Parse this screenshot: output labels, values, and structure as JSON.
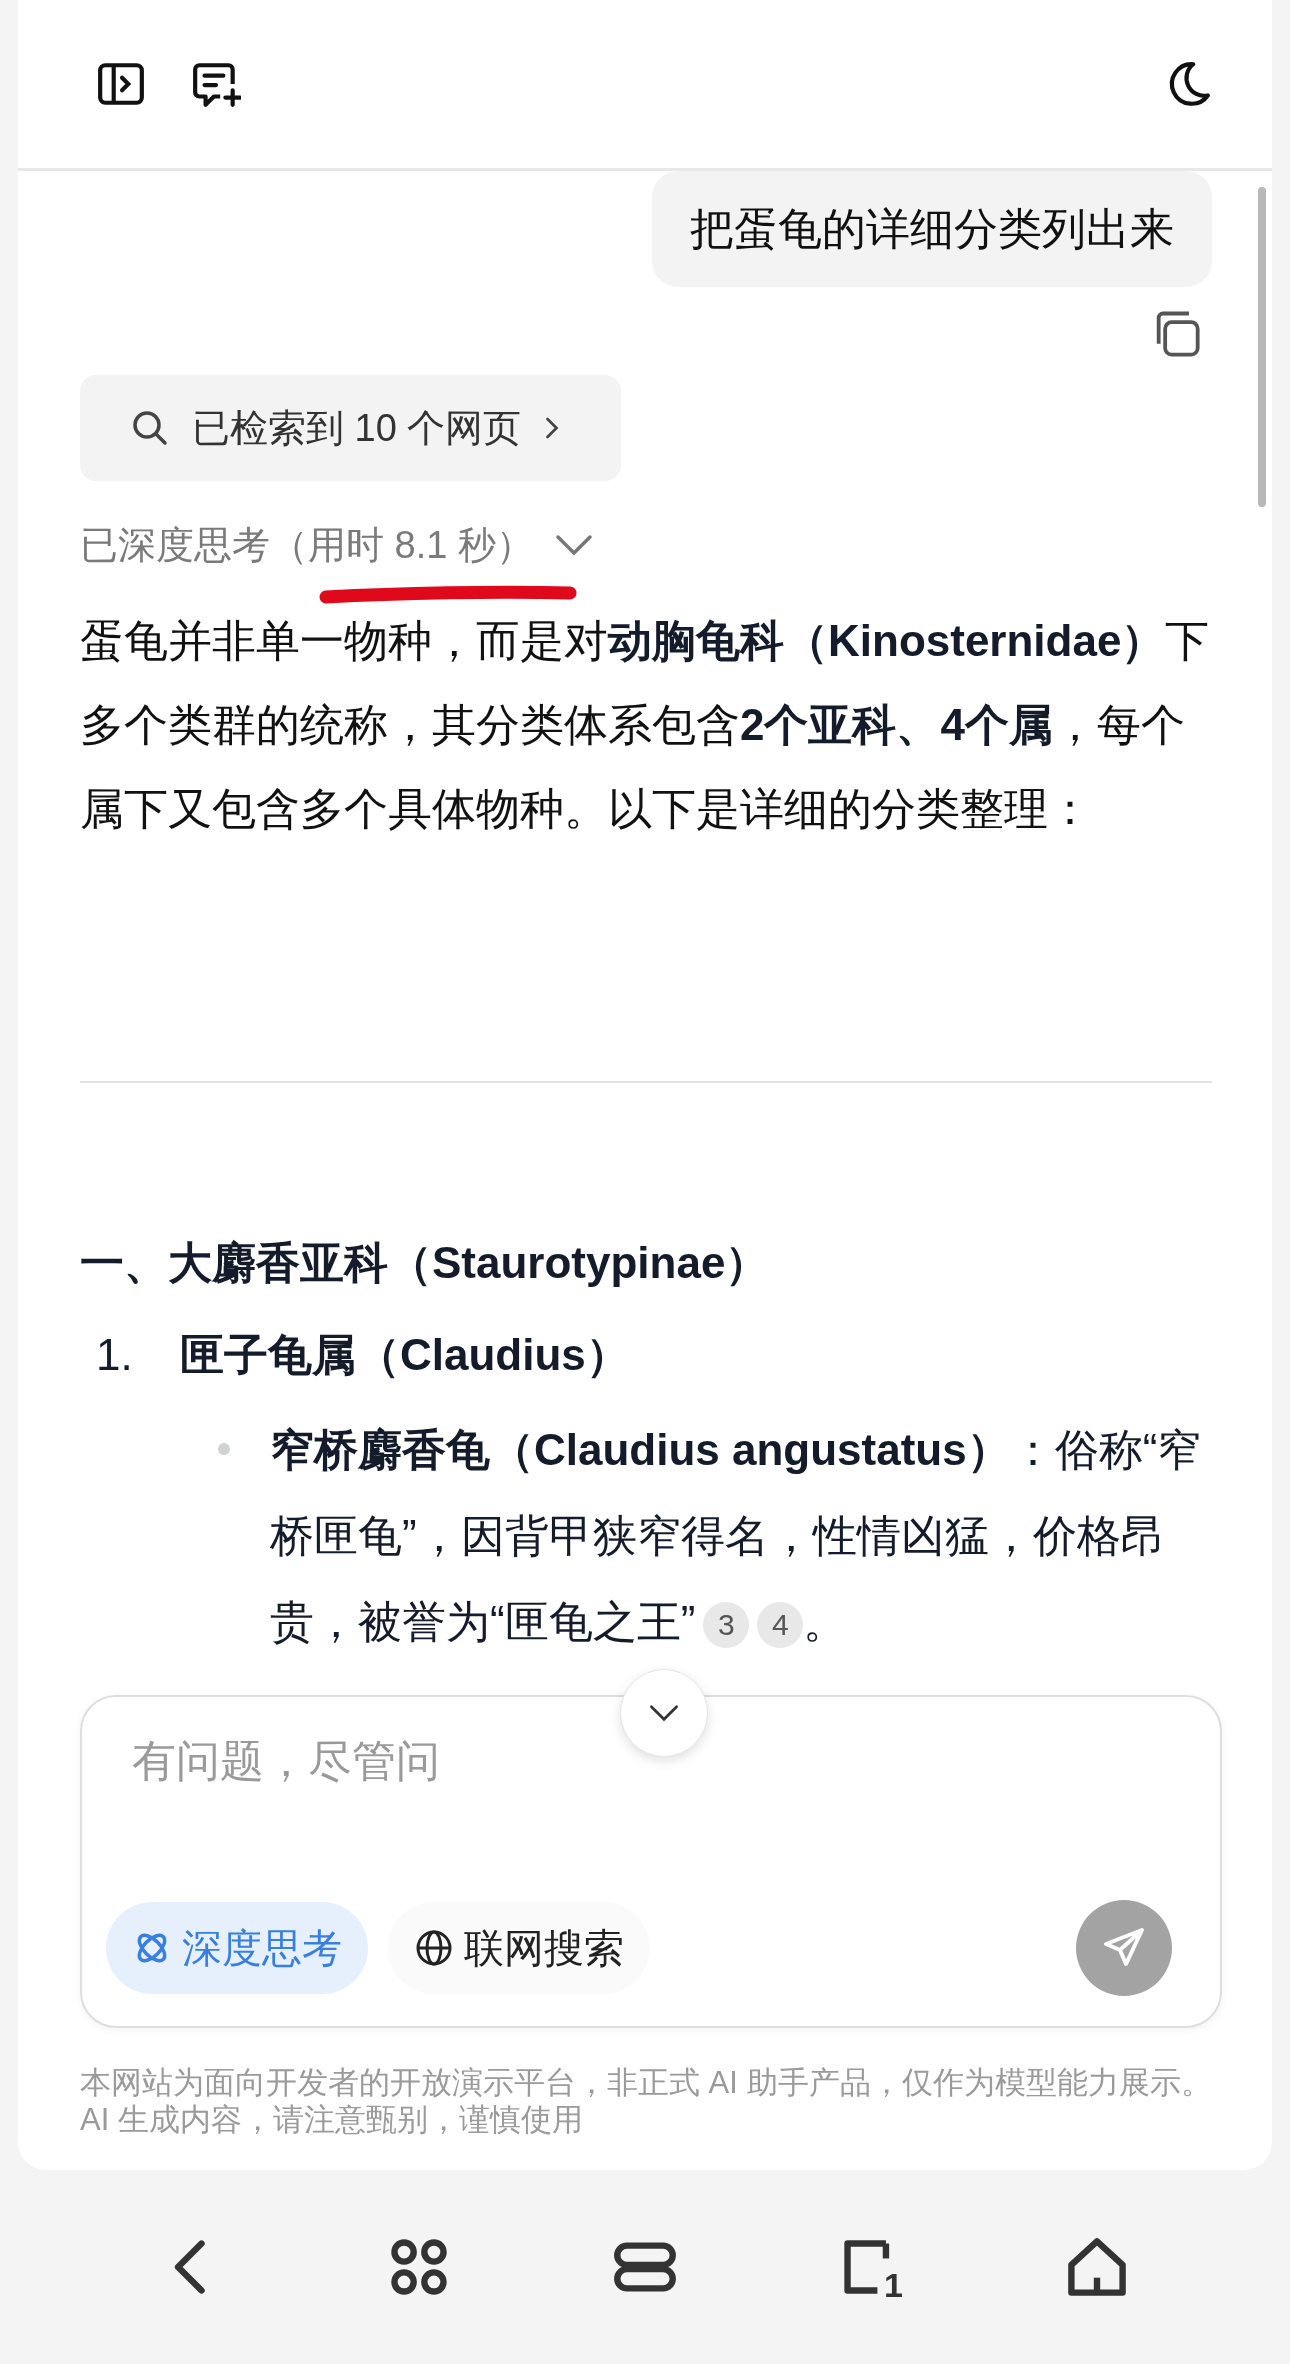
{
  "user_message": "把蛋龟的详细分类列出来",
  "search_result": "已检索到 10 个网页",
  "thinking": "已深度思考（用时 8.1 秒）",
  "answer": {
    "intro": "蛋龟并非单一物种，而是对**动胸龟科（Kinosternidae）**下多个类群的统称，其分类体系包含**2个亚科、4个属**，每个属下又包含多个具体物种。以下是详细的分类整理：",
    "heading": "一、大麝香亚科（Staurotypinae）",
    "numbered": {
      "number": "1.",
      "text": "匣子龟属（Claudius）"
    },
    "bullet": {
      "text": "**窄桥麝香龟（Claudius angustatus）**：俗称“窄桥匣龟”，因背甲狭窄得名，性情凶猛，价格昂贵，被誉为“匣龟之王”",
      "citations": [
        "3",
        "4"
      ],
      "end": "。"
    }
  },
  "composer": {
    "placeholder": "有问题，尽管问",
    "toggles": [
      {
        "label": "深度思考",
        "kind": "deep-think",
        "selected": true
      },
      {
        "label": "联网搜索",
        "kind": "web-search",
        "selected": false
      }
    ]
  },
  "disclaimer": "本网站为面向开发者的开放演示平台，非正式 AI 助手产品，仅作为模型能力展示。AI 生成内容，请注意甄别，谨慎使用",
  "nav": {
    "tab_count": "1"
  }
}
